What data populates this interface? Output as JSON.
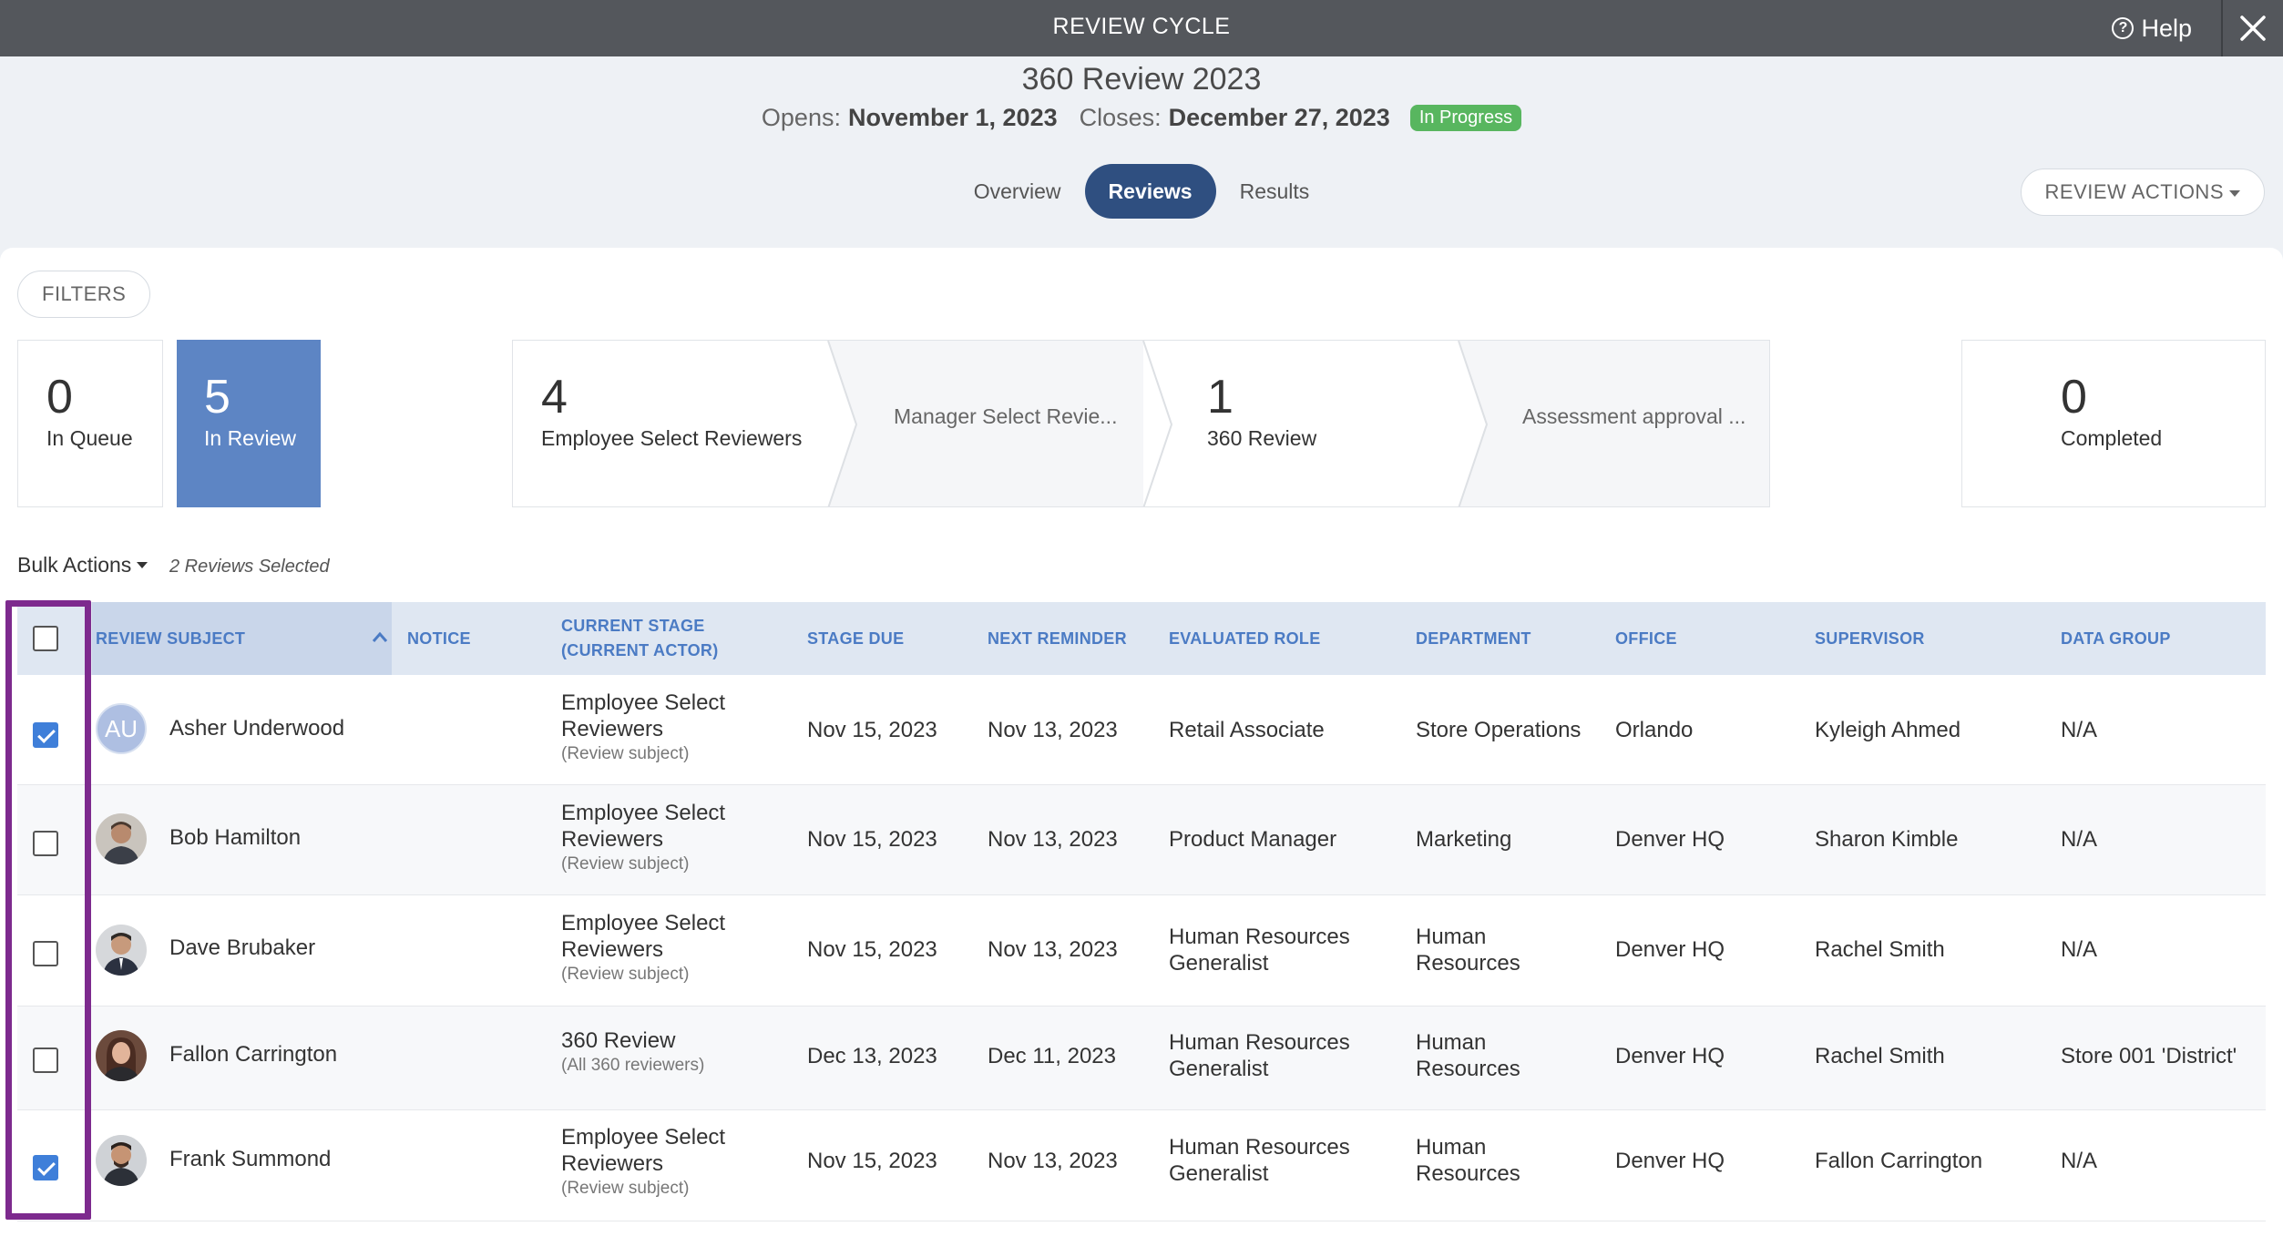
{
  "topbar": {
    "title": "REVIEW CYCLE",
    "help_label": "Help"
  },
  "header": {
    "cycle_name": "360 Review 2023",
    "opens_label": "Opens:",
    "opens_date": "November 1, 2023",
    "closes_label": "Closes:",
    "closes_date": "December 27, 2023",
    "status_badge": "In Progress"
  },
  "tabs": [
    {
      "label": "Overview",
      "active": false
    },
    {
      "label": "Reviews",
      "active": true
    },
    {
      "label": "Results",
      "active": false
    }
  ],
  "review_actions_label": "REVIEW ACTIONS",
  "filters_label": "FILTERS",
  "stats": {
    "in_queue": {
      "count": "0",
      "label": "In Queue"
    },
    "in_review": {
      "count": "5",
      "label": "In Review"
    },
    "completed": {
      "count": "0",
      "label": "Completed"
    }
  },
  "stages": [
    {
      "count": "4",
      "label": "Employee Select Reviewers"
    },
    {
      "count": "",
      "label": "Manager Select Revie..."
    },
    {
      "count": "1",
      "label": "360 Review"
    },
    {
      "count": "",
      "label": "Assessment approval ..."
    }
  ],
  "bulk_actions_label": "Bulk Actions",
  "selected_count": "2 Reviews Selected",
  "columns": {
    "review_subject": "REVIEW SUBJECT",
    "notice": "NOTICE",
    "current_stage_1": "CURRENT STAGE",
    "current_stage_2": "(CURRENT ACTOR)",
    "stage_due": "STAGE DUE",
    "next_reminder": "NEXT REMINDER",
    "evaluated_role": "EVALUATED ROLE",
    "department": "DEPARTMENT",
    "office": "OFFICE",
    "supervisor": "SUPERVISOR",
    "data_group": "DATA GROUP"
  },
  "rows": [
    {
      "checked": true,
      "avatar_initials": "AU",
      "name": "Asher Underwood",
      "stage": "Employee Select Reviewers",
      "actor": "(Review subject)",
      "stage_due": "Nov 15, 2023",
      "next_reminder": "Nov 13, 2023",
      "role": "Retail Associate",
      "department": "Store Operations",
      "office": "Orlando",
      "supervisor": "Kyleigh Ahmed",
      "data_group": "N/A"
    },
    {
      "checked": false,
      "avatar_initials": "",
      "name": "Bob Hamilton",
      "stage": "Employee Select Reviewers",
      "actor": "(Review subject)",
      "stage_due": "Nov 15, 2023",
      "next_reminder": "Nov 13, 2023",
      "role": "Product Manager",
      "department": "Marketing",
      "office": "Denver HQ",
      "supervisor": "Sharon Kimble",
      "data_group": "N/A"
    },
    {
      "checked": false,
      "avatar_initials": "",
      "name": "Dave Brubaker",
      "stage": "Employee Select Reviewers",
      "actor": "(Review subject)",
      "stage_due": "Nov 15, 2023",
      "next_reminder": "Nov 13, 2023",
      "role": "Human Resources Generalist",
      "department": "Human Resources",
      "office": "Denver HQ",
      "supervisor": "Rachel Smith",
      "data_group": "N/A"
    },
    {
      "checked": false,
      "avatar_initials": "",
      "name": "Fallon Carrington",
      "stage": "360 Review",
      "actor": "(All 360 reviewers)",
      "stage_due": "Dec 13, 2023",
      "next_reminder": "Dec 11, 2023",
      "role": "Human Resources Generalist",
      "department": "Human Resources",
      "office": "Denver HQ",
      "supervisor": "Rachel Smith",
      "data_group": "Store 001 'District'"
    },
    {
      "checked": true,
      "avatar_initials": "",
      "name": "Frank Summond",
      "stage": "Employee Select Reviewers",
      "actor": "(Review subject)",
      "stage_due": "Nov 15, 2023",
      "next_reminder": "Nov 13, 2023",
      "role": "Human Resources Generalist",
      "department": "Human Resources",
      "office": "Denver HQ",
      "supervisor": "Fallon Carrington",
      "data_group": "N/A"
    }
  ],
  "colors": {
    "topbar": "#54575c",
    "accent": "#2f4f80",
    "in_review": "#5d85c4",
    "badge": "#58b65f",
    "checkbox": "#3f7fd9",
    "highlight": "#7d2a8e"
  }
}
